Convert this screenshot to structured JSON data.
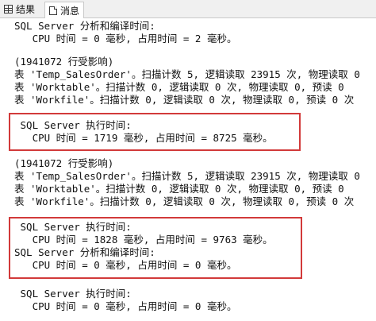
{
  "tabs": {
    "results_label": "结果",
    "messages_label": "消息"
  },
  "messages": [
    "SQL Server 分析和编译时间:",
    "   CPU 时间 = 0 毫秒, 占用时间 = 2 毫秒。",
    "",
    "(1941072 行受影响)",
    "表 'Temp_SalesOrder'。扫描计数 5, 逻辑读取 23915 次, 物理读取 0",
    "表 'Worktable'。扫描计数 0, 逻辑读取 0 次, 物理读取 0, 预读 0",
    "表 'Workfile'。扫描计数 0, 逻辑读取 0 次, 物理读取 0, 预读 0 次",
    "",
    " SQL Server 执行时间:",
    "   CPU 时间 = 1719 毫秒, 占用时间 = 8725 毫秒。",
    "",
    "(1941072 行受影响)",
    "表 'Temp_SalesOrder'。扫描计数 5, 逻辑读取 23915 次, 物理读取 0",
    "表 'Worktable'。扫描计数 0, 逻辑读取 0 次, 物理读取 0, 预读 0",
    "表 'Workfile'。扫描计数 0, 逻辑读取 0 次, 物理读取 0, 预读 0 次",
    "",
    " SQL Server 执行时间:",
    "   CPU 时间 = 1828 毫秒, 占用时间 = 9763 毫秒。",
    "SQL Server 分析和编译时间:",
    "   CPU 时间 = 0 毫秒, 占用时间 = 0 毫秒。",
    "",
    " SQL Server 执行时间:",
    "   CPU 时间 = 0 毫秒, 占用时间 = 0 毫秒。"
  ],
  "highlight_color": "#d23a3a"
}
